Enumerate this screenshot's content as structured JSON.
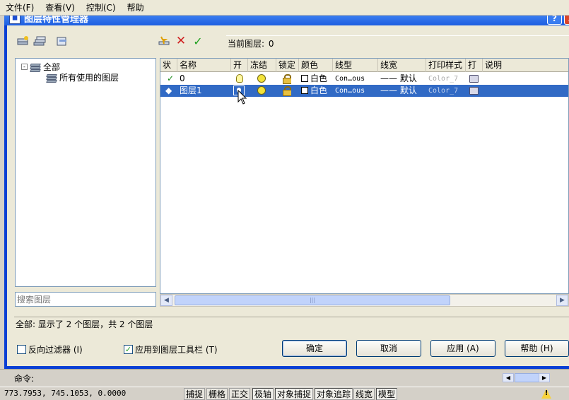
{
  "menu": [
    "文件(F)",
    "查看(V)",
    "控制(C)",
    "帮助"
  ],
  "dialog": {
    "title": "图层特性管理器",
    "help_button": "?",
    "close_button": "X"
  },
  "current_layer": {
    "label": "当前图层:",
    "value": "0"
  },
  "tree": {
    "root": "全部",
    "child": "所有使用的图层",
    "expander": "-"
  },
  "search": {
    "placeholder": "搜索图层"
  },
  "columns": [
    "状",
    "名称",
    "开",
    "冻结",
    "锁定",
    "颜色",
    "线型",
    "线宽",
    "打印样式",
    "打",
    "说明"
  ],
  "rows": [
    {
      "status_icon": "checkmark-icon",
      "name": "0",
      "color": "白色",
      "linetype": "Con…ous",
      "lineweight": "—— 默认",
      "plotstyle": "Color_7",
      "selected": false
    },
    {
      "status_icon": "layer-icon",
      "name": "图层1",
      "color": "白色",
      "linetype": "Con…ous",
      "lineweight": "—— 默认",
      "plotstyle": "Color_7",
      "selected": true
    }
  ],
  "summary": "全部: 显示了 2 个图层，共 2 个图层",
  "checkboxes": {
    "invert_filter": {
      "label": "反向过滤器 (I)",
      "checked": false
    },
    "apply_toolbar": {
      "label": "应用到图层工具栏 (T)",
      "checked": true
    }
  },
  "buttons": {
    "ok": "确定",
    "cancel": "取消",
    "apply": "应用 (A)",
    "help": "帮助 (H)"
  },
  "command": {
    "label": "命令:"
  },
  "status": {
    "coords": "773.7953,  745.1053, 0.0000",
    "toggles": [
      {
        "label": "捕捉",
        "on": false
      },
      {
        "label": "栅格",
        "on": false
      },
      {
        "label": "正交",
        "on": false
      },
      {
        "label": "极轴",
        "on": true
      },
      {
        "label": "对象捕捉",
        "on": true
      },
      {
        "label": "对象追踪",
        "on": true
      },
      {
        "label": "线宽",
        "on": false
      },
      {
        "label": "模型",
        "on": true
      }
    ]
  },
  "colors": {
    "selection": "#316ac5",
    "titlebar": "#0a3fd4",
    "dialog_bg": "#ece9d8"
  }
}
